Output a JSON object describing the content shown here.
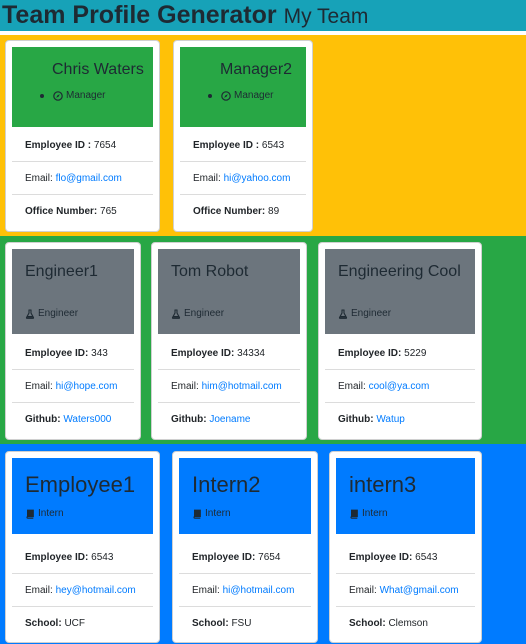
{
  "header": {
    "title": "Team Profile Generator",
    "subtitle": "My Team"
  },
  "labels": {
    "id": "Employee ID:",
    "id_manager": "Employee ID :",
    "email": "Email:",
    "office": "Office Number:",
    "github": "Github:",
    "school": "School:"
  },
  "managers": [
    {
      "name": "Chris Waters",
      "role": "Manager",
      "id": "7654",
      "email": "flo@gmail.com",
      "office": "765"
    },
    {
      "name": "Manager2",
      "role": "Manager",
      "id": "6543",
      "email": "hi@yahoo.com",
      "office": "89"
    }
  ],
  "engineers": [
    {
      "name": "Engineer1",
      "role": "Engineer",
      "id": "343",
      "email": "hi@hope.com",
      "github": "Waters000"
    },
    {
      "name": "Tom Robot",
      "role": "Engineer",
      "id": "34334",
      "email": "him@hotmail.com",
      "github": "Joename"
    },
    {
      "name": "Engineering Cool",
      "role": "Engineer",
      "id": "5229",
      "email": "cool@ya.com",
      "github": "Watup"
    }
  ],
  "interns": [
    {
      "name": "Employee1",
      "role": "Intern",
      "id": "6543",
      "email": "hey@hotmail.com",
      "school": "UCF"
    },
    {
      "name": "Intern2",
      "role": "Intern",
      "id": "7654",
      "email": "hi@hotmail.com",
      "school": "FSU"
    },
    {
      "name": "intern3",
      "role": "Intern",
      "id": "6543",
      "email": "What@gmail.com",
      "school": "Clemson"
    }
  ],
  "icons": {
    "manager": "compass-icon",
    "engineer": "flask-icon",
    "intern": "book-icon"
  },
  "colors": {
    "header": "#17a2b8",
    "managers_bg": "#ffc107",
    "engineers_bg": "#28a745",
    "interns_bg": "#007bff",
    "manager_card": "#28a745",
    "engineer_card": "#6c757d",
    "intern_card": "#007bff"
  }
}
